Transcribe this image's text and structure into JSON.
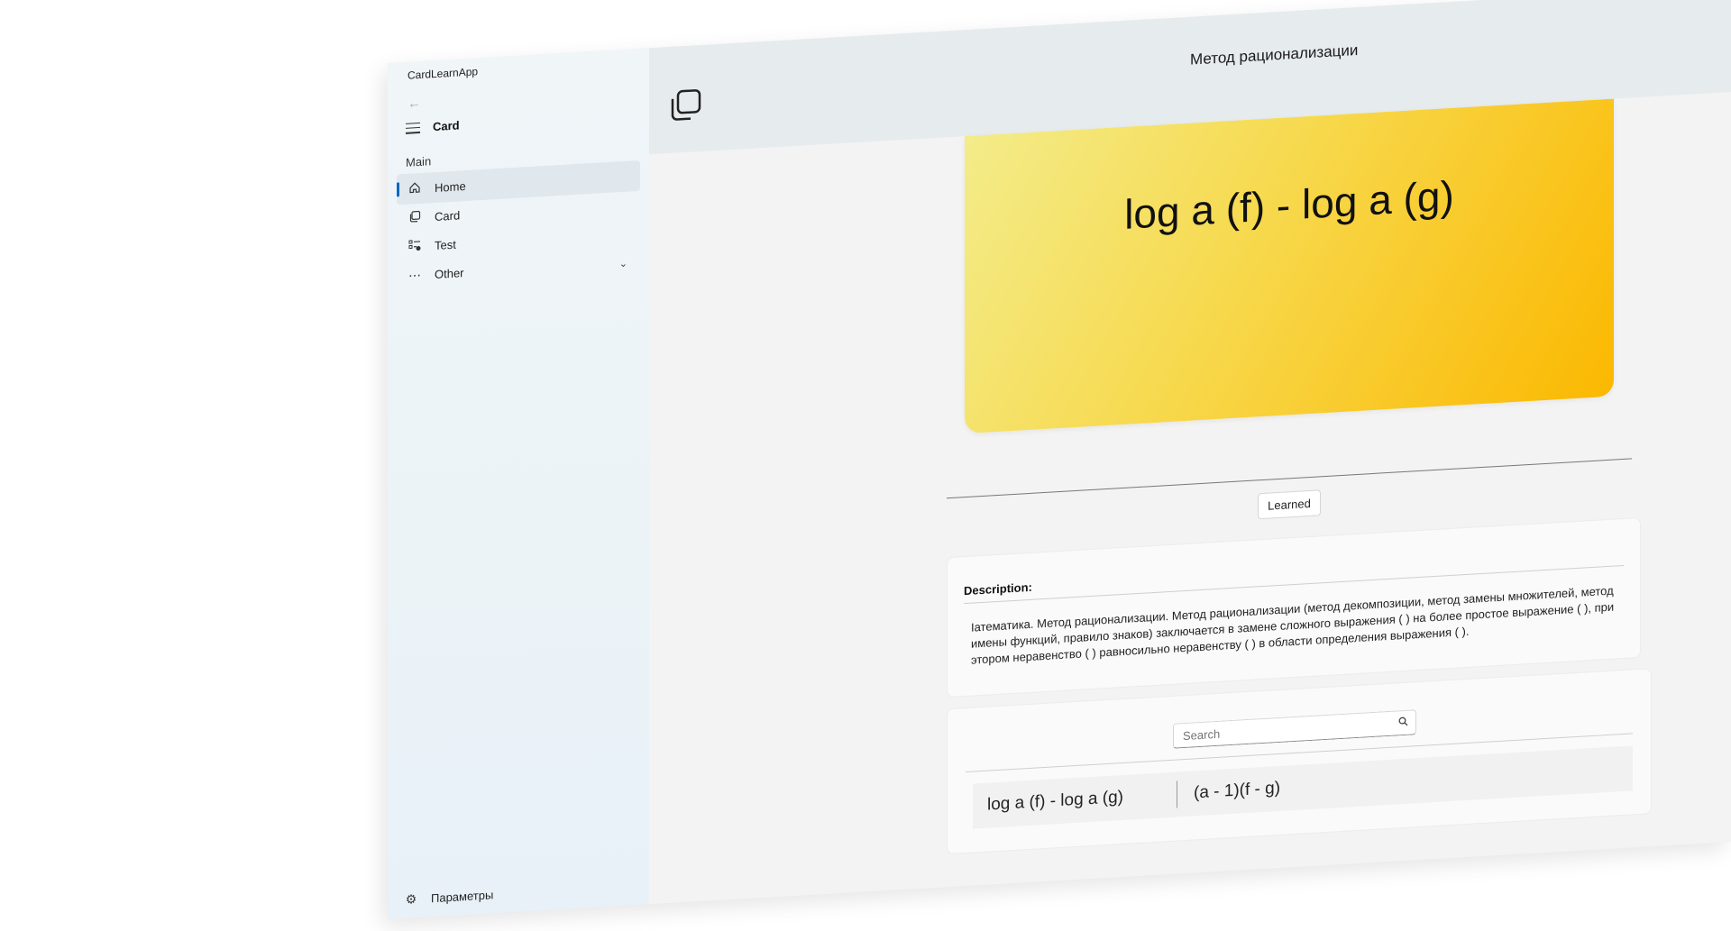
{
  "app": {
    "title": "CardLearnApp"
  },
  "nav": {
    "back": "←",
    "header_label": "Card",
    "section_label": "Main",
    "items": [
      {
        "label": "Home",
        "icon": "home-icon",
        "active": true
      },
      {
        "label": "Card",
        "icon": "card-icon"
      },
      {
        "label": "Test",
        "icon": "test-icon"
      },
      {
        "label": "Other",
        "icon": "more-icon"
      }
    ],
    "settings_label": "Параметры"
  },
  "header": {
    "title": "Метод рационализации"
  },
  "card": {
    "front": "log a (f) - log a (g)",
    "colors": {
      "start": "#f3ec8a",
      "end": "#fbb800"
    }
  },
  "actions": {
    "learned_label": "Learned"
  },
  "description": {
    "title": "Description:",
    "text": "Iатематика. Метод рационализации. Метод рационализации (метод декомпозиции, метод замены множителей, метод имены функций, правило знаков) заключается в замене сложного выражения ( ) на более простое выражение ( ), при этором неравенство ( ) равносильно неравенству ( ) в области определения выражения ( )."
  },
  "search": {
    "placeholder": "Search"
  },
  "list": {
    "rows": [
      {
        "front": "log a (f) - log a (g)",
        "back": "(a - 1)(f - g)"
      }
    ]
  }
}
